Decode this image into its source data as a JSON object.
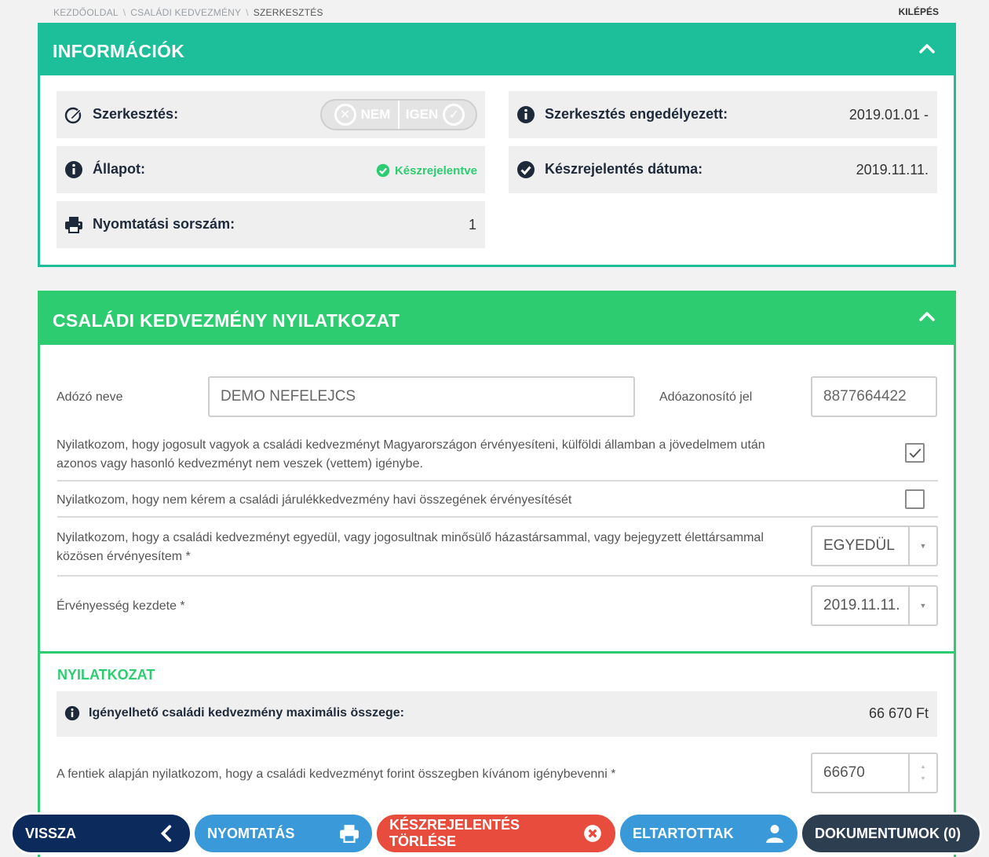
{
  "breadcrumb": [
    "KEZDŐOLDAL",
    "CSALÁDI KEDVEZMÉNY",
    "SZERKESZTÉS"
  ],
  "logout": "KILÉPÉS",
  "info": {
    "title": "INFORMÁCIÓK",
    "editing_label": "Szerkesztés:",
    "toggle_no": "NEM",
    "toggle_yes": "IGEN",
    "status_label": "Állapot:",
    "status_value": "Készrejelentve",
    "print_label": "Nyomtatási sorszám:",
    "print_value": "1",
    "allowed_label": "Szerkesztés engedélyezett:",
    "allowed_value": "2019.01.01 -",
    "report_date_label": "Készrejelentés dátuma:",
    "report_date_value": "2019.11.11."
  },
  "decl": {
    "title": "CSALÁDI KEDVEZMÉNY NYILATKOZAT",
    "taxpayer_label": "Adózó neve",
    "taxpayer_value": "DEMO NEFELEJCS",
    "taxid_label": "Adóazonosító jel",
    "taxid_value": "8877664422",
    "stmt1_line1": "Nyilatkozom, hogy jogosult vagyok a családi kedvezményt Magyarországon érvényesíteni, külföldi államban a jövedelmem után",
    "stmt1_line2": "azonos vagy hasonló kedvezményt nem veszek (vettem) igénybe.",
    "stmt1_checked": true,
    "stmt2": "Nyilatkozom, hogy nem kérem a családi járulékkedvezmény havi összegének érvényesítését",
    "stmt2_checked": false,
    "stmt3_line1": "Nyilatkozom, hogy a családi kedvezményt egyedül, vagy jogosultnak minősülő házastársammal, vagy bejegyzett élettársammal",
    "stmt3_line2": "közösen érvényesítem *",
    "stmt3_value": "EGYEDÜL",
    "validity_label": "Érvényesség kezdete *",
    "validity_value": "2019.11.11.",
    "sub_title": "NYILATKOZAT",
    "max_label": "Igényelhető családi kedvezmény maximális összege:",
    "max_value": "66 670 Ft",
    "amount_label": "A fentiek alapján nyilatkozom, hogy a családi kedvezményt forint összegben kívánom igénybevenni *",
    "amount_value": "66670"
  },
  "buttons": {
    "back": "VISSZA",
    "print": "NYOMTATÁS",
    "delete_report": "KÉSZREJELENTÉS TÖRLÉSE",
    "dependents": "ELTARTOTTAK",
    "documents": "DOKUMENTUMOK (0)"
  },
  "colors": {
    "info_header": "#1dbf9a",
    "decl_header": "#2ecc71",
    "back_btn": "#0d2a5c",
    "print_btn": "#3a9ad9",
    "delete_btn": "#e74c3c",
    "dependents_btn": "#3a9ad9",
    "documents_btn": "#2c3e50"
  }
}
